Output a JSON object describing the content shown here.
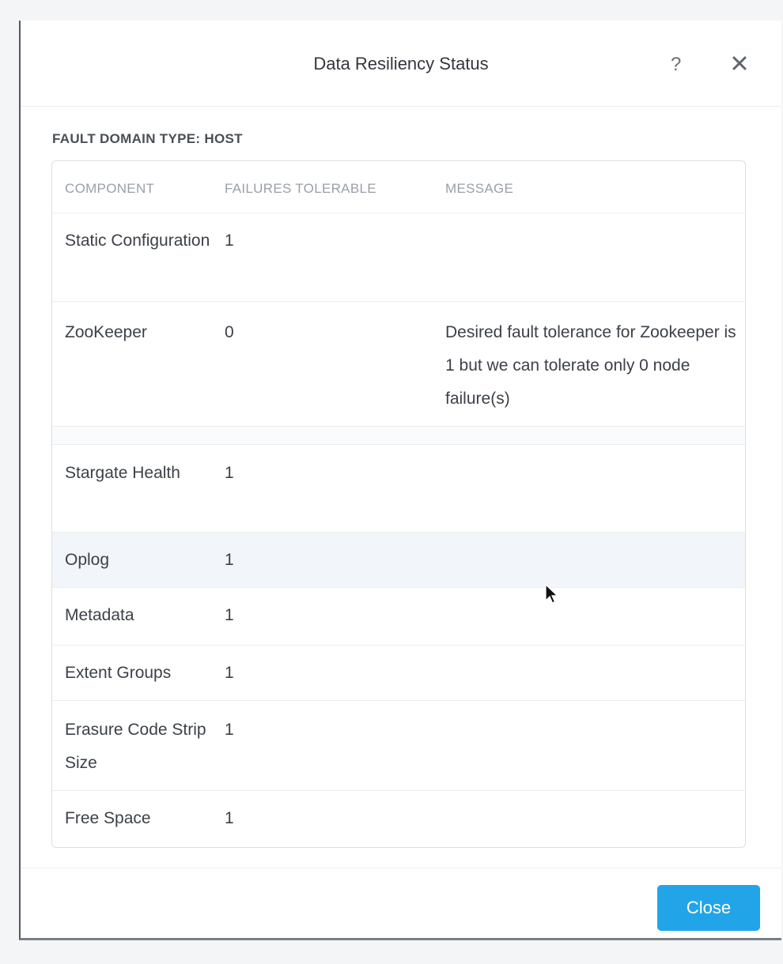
{
  "dialog": {
    "title": "Data Resiliency Status",
    "help_label": "?",
    "close_icon": "close-icon",
    "section_title": "FAULT DOMAIN TYPE: HOST",
    "close_button": "Close"
  },
  "table": {
    "headers": [
      "COMPONENT",
      "FAILURES TOLERABLE",
      "MESSAGE"
    ],
    "rows": [
      {
        "component": "Static Configuration",
        "failures": "1",
        "message": ""
      },
      {
        "component": "ZooKeeper",
        "failures": "0",
        "message": "Desired fault tolerance for Zookeeper is 1 but we can tolerate only 0 node failure(s)"
      },
      {
        "component": "Stargate Health",
        "failures": "1",
        "message": ""
      },
      {
        "component": "Oplog",
        "failures": "1",
        "message": ""
      },
      {
        "component": "Metadata",
        "failures": "1",
        "message": ""
      },
      {
        "component": "Extent Groups",
        "failures": "1",
        "message": ""
      },
      {
        "component": "Erasure Code Strip Size",
        "failures": "1",
        "message": ""
      },
      {
        "component": "Free Space",
        "failures": "1",
        "message": ""
      }
    ]
  },
  "colors": {
    "primary_button": "#22a5e8",
    "highlight_row": "#f2f6fa"
  }
}
